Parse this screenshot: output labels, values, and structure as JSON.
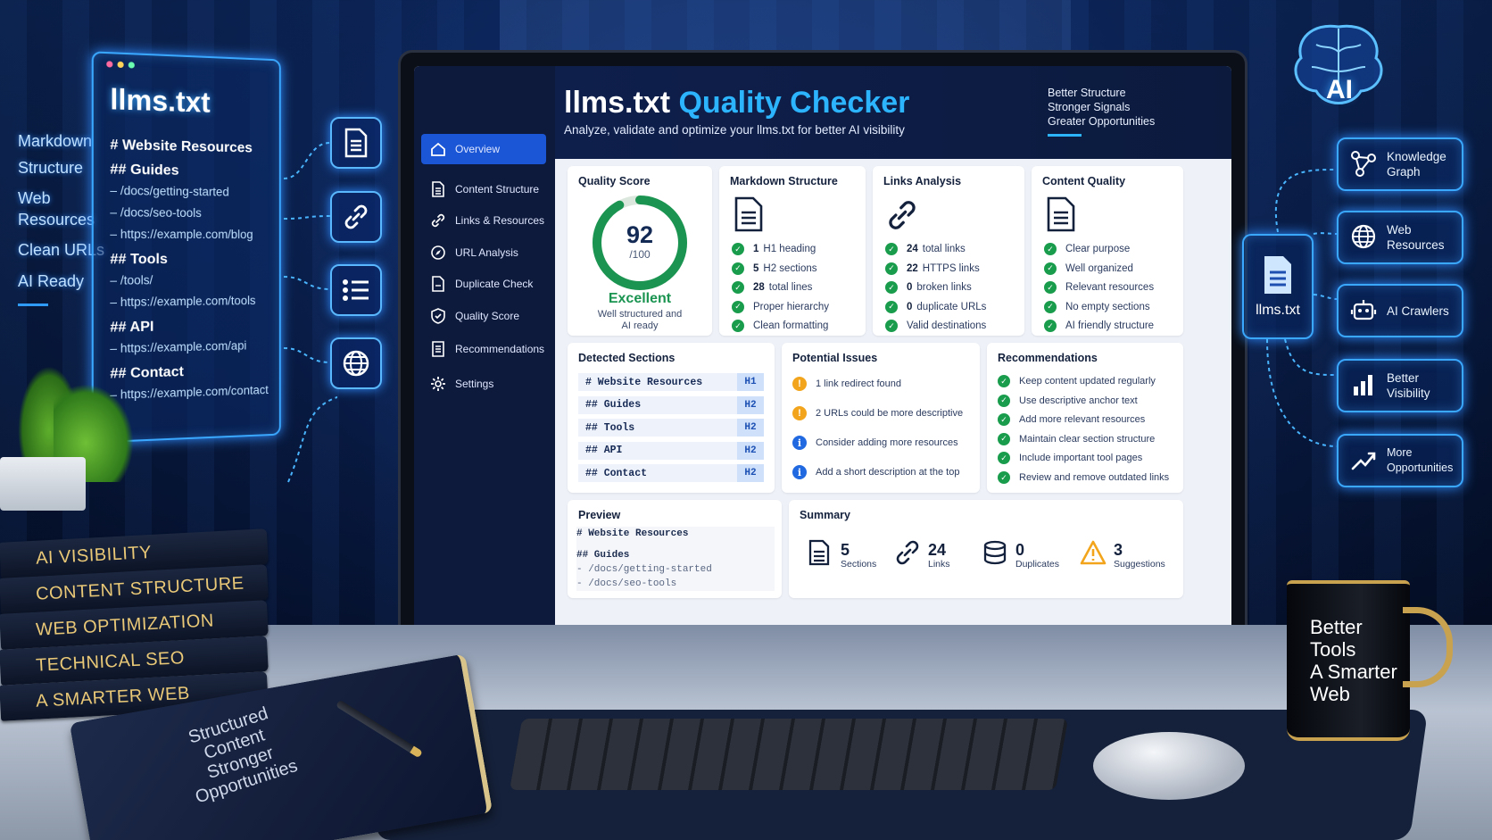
{
  "app": {
    "title_plain": "llms.txt ",
    "title_accent": "Quality Checker",
    "subtitle": "Analyze, validate and optimize your llms.txt for better AI visibility",
    "taglines": [
      "Better Structure",
      "Stronger Signals",
      "Greater Opportunities"
    ]
  },
  "sidebar": {
    "items": [
      {
        "label": "Overview",
        "icon": "home-icon",
        "active": true
      },
      {
        "label": "Content Structure",
        "icon": "document-icon"
      },
      {
        "label": "Links & Resources",
        "icon": "link-icon"
      },
      {
        "label": "URL Analysis",
        "icon": "compass-icon"
      },
      {
        "label": "Duplicate Check",
        "icon": "duplicate-icon"
      },
      {
        "label": "Quality Score",
        "icon": "shield-icon"
      },
      {
        "label": "Recommendations",
        "icon": "list-icon"
      },
      {
        "label": "Settings",
        "icon": "gear-icon"
      }
    ]
  },
  "quality": {
    "title": "Quality Score",
    "score": "92",
    "max": "/100",
    "score_fraction": 0.92,
    "rating": "Excellent",
    "desc_line1": "Well structured and",
    "desc_line2": "AI ready"
  },
  "markdown": {
    "title": "Markdown Structure",
    "rows": [
      {
        "num": "1",
        "text": "H1 heading"
      },
      {
        "num": "5",
        "text": "H2 sections"
      },
      {
        "num": "28",
        "text": "total lines"
      },
      {
        "num": "",
        "text": "Proper hierarchy"
      },
      {
        "num": "",
        "text": "Clean formatting"
      }
    ]
  },
  "links": {
    "title": "Links Analysis",
    "rows": [
      {
        "num": "24",
        "text": "total links"
      },
      {
        "num": "22",
        "text": "HTTPS links"
      },
      {
        "num": "0",
        "text": "broken links"
      },
      {
        "num": "0",
        "text": "duplicate URLs"
      },
      {
        "num": "",
        "text": "Valid destinations"
      }
    ]
  },
  "content": {
    "title": "Content Quality",
    "rows": [
      "Clear purpose",
      "Well organized",
      "Relevant resources",
      "No empty sections",
      "AI friendly structure"
    ]
  },
  "detected": {
    "title": "Detected Sections",
    "rows": [
      {
        "name": "#  Website Resources",
        "level": "H1"
      },
      {
        "name": "##  Guides",
        "level": "H2"
      },
      {
        "name": "##  Tools",
        "level": "H2"
      },
      {
        "name": "##  API",
        "level": "H2"
      },
      {
        "name": "##  Contact",
        "level": "H2"
      }
    ]
  },
  "issues": {
    "title": "Potential Issues",
    "rows": [
      {
        "type": "warning",
        "text": "1 link redirect found"
      },
      {
        "type": "warning",
        "text": "2 URLs could be more descriptive"
      },
      {
        "type": "info",
        "text": "Consider adding more resources"
      },
      {
        "type": "info",
        "text": "Add a short description at the top"
      }
    ]
  },
  "recs": {
    "title": "Recommendations",
    "rows": [
      "Keep content updated regularly",
      "Use descriptive anchor text",
      "Add more relevant resources",
      "Maintain clear section structure",
      "Include important tool pages",
      "Review and remove outdated links"
    ]
  },
  "preview": {
    "title": "Preview",
    "lines": [
      "# Website Resources",
      "## Guides",
      "- /docs/getting-started",
      "- /docs/seo-tools"
    ]
  },
  "summary": {
    "title": "Summary",
    "items": [
      {
        "value": "5",
        "label": "Sections",
        "icon": "document-icon"
      },
      {
        "value": "24",
        "label": "Links",
        "icon": "link-icon"
      },
      {
        "value": "0",
        "label": "Duplicates",
        "icon": "database-icon"
      },
      {
        "value": "3",
        "label": "Suggestions",
        "icon": "warning-icon"
      }
    ]
  },
  "holo_doc": {
    "title": "llms.txt",
    "lines": [
      {
        "t": "#  Website Resources",
        "k": "h"
      },
      {
        "t": "##  Guides",
        "k": "h"
      },
      {
        "t": "–  /docs/getting-started",
        "k": "l"
      },
      {
        "t": "–  /docs/seo-tools",
        "k": "l"
      },
      {
        "t": "–  https://example.com/blog",
        "k": "l"
      },
      {
        "t": "##  Tools",
        "k": "h"
      },
      {
        "t": "–  /tools/",
        "k": "l"
      },
      {
        "t": "–  https://example.com/tools",
        "k": "l"
      },
      {
        "t": "##  API",
        "k": "h"
      },
      {
        "t": "–  https://example.com/api",
        "k": "l"
      },
      {
        "t": "##  Contact",
        "k": "h"
      },
      {
        "t": "–  https://example.com/contact",
        "k": "l"
      }
    ]
  },
  "left_labels": [
    "Markdown",
    "Structure",
    "Web",
    "Resources",
    "Clean URLs",
    "AI Ready"
  ],
  "right": {
    "brain_label": "AI",
    "file_label": "llms.txt",
    "panels": [
      {
        "label": "Knowledge Graph",
        "icon": "graph-icon"
      },
      {
        "label": "Web Resources",
        "icon": "globe-icon"
      },
      {
        "label": "AI Crawlers",
        "icon": "robot-icon"
      },
      {
        "label": "Better Visibility",
        "icon": "bar-chart-icon"
      },
      {
        "label": "More Opportunities",
        "icon": "trend-icon"
      }
    ]
  },
  "books": [
    "AI VISIBILITY",
    "CONTENT STRUCTURE",
    "WEB OPTIMIZATION",
    "TECHNICAL SEO",
    "A SMARTER WEB"
  ],
  "notebook": [
    "Structured",
    "Content",
    "Stronger",
    "Opportunities"
  ],
  "mug": [
    "Better",
    "Tools",
    "A Smarter",
    "Web"
  ],
  "colors": {
    "accent": "#1e9bff",
    "success": "#1a9c4d",
    "warning": "#f2a51c",
    "info": "#2169e0",
    "nav_bg": "#0e1a3c"
  }
}
